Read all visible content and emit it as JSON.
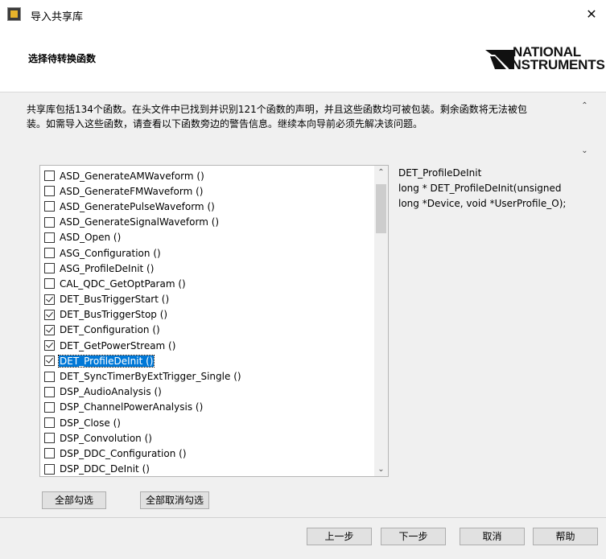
{
  "window": {
    "title": "导入共享库",
    "close_glyph": "✕"
  },
  "header": {
    "step_title": "选择待转换函数",
    "logo_line1": "NATIONAL",
    "logo_line2": "INSTRUMENTS"
  },
  "description": {
    "line1": "共享库包括134个函数。在头文件中已找到并识别121个函数的声明，并且这些函数均可被包装。剩余函数将无法被包",
    "line2": "装。如需导入这些函数，请查看以下函数旁边的警告信息。继续本向导前必须先解决该问题。"
  },
  "function_list": {
    "items": [
      {
        "label": "ASD_GenerateAMWaveform ()",
        "checked": false
      },
      {
        "label": "ASD_GenerateFMWaveform ()",
        "checked": false
      },
      {
        "label": "ASD_GeneratePulseWaveform ()",
        "checked": false
      },
      {
        "label": "ASD_GenerateSignalWaveform ()",
        "checked": false
      },
      {
        "label": "ASD_Open ()",
        "checked": false
      },
      {
        "label": "ASG_Configuration ()",
        "checked": false
      },
      {
        "label": "ASG_ProfileDeInit ()",
        "checked": false
      },
      {
        "label": "CAL_QDC_GetOptParam ()",
        "checked": false
      },
      {
        "label": "DET_BusTriggerStart ()",
        "checked": true
      },
      {
        "label": "DET_BusTriggerStop ()",
        "checked": true
      },
      {
        "label": "DET_Configuration ()",
        "checked": true
      },
      {
        "label": "DET_GetPowerStream ()",
        "checked": true
      },
      {
        "label": "DET_ProfileDeInit ()",
        "checked": true,
        "selected": true
      },
      {
        "label": "DET_SyncTimerByExtTrigger_Single ()",
        "checked": false
      },
      {
        "label": "DSP_AudioAnalysis ()",
        "checked": false
      },
      {
        "label": "DSP_ChannelPowerAnalysis ()",
        "checked": false
      },
      {
        "label": "DSP_Close ()",
        "checked": false
      },
      {
        "label": "DSP_Convolution ()",
        "checked": false
      },
      {
        "label": "DSP_DDC_Configuration ()",
        "checked": false
      },
      {
        "label": "DSP_DDC_DeInit ()",
        "checked": false
      }
    ]
  },
  "detail": {
    "name": "DET_ProfileDeInit",
    "sig_line1": "long * DET_ProfileDeInit(unsigned",
    "sig_line2": "long *Device, void *UserProfile_O);"
  },
  "buttons": {
    "select_all": "全部勾选",
    "deselect_all": "全部取消勾选",
    "back": "上一步",
    "next": "下一步",
    "cancel": "取消",
    "help": "帮助"
  },
  "scroll_arrows": {
    "up": "⌃",
    "down": "⌄"
  }
}
